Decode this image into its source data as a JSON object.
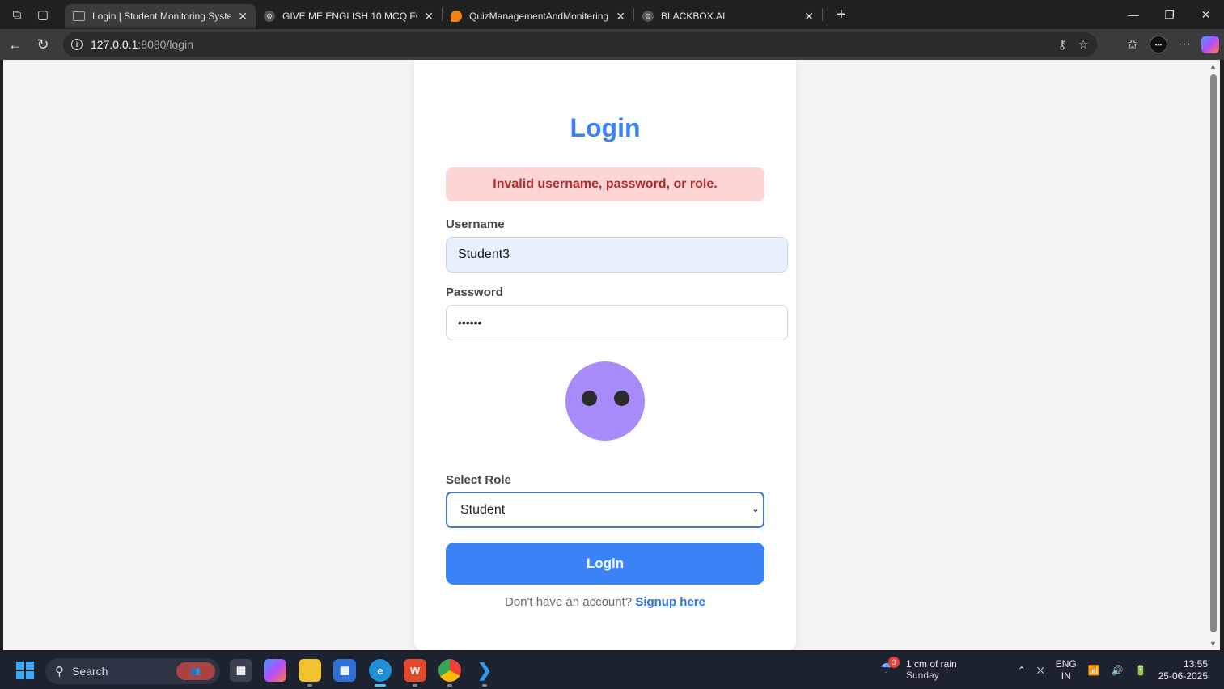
{
  "browser": {
    "tabs": [
      {
        "title": "Login | Student Monitoring Syster",
        "active": true
      },
      {
        "title": "GIVE ME ENGLISH 10 MCQ FOR 8",
        "active": false
      },
      {
        "title": "QuizManagementAndMonitering",
        "active": false
      },
      {
        "title": "BLACKBOX.AI",
        "active": false
      }
    ],
    "url_host": "127.0.0.1",
    "url_path": ":8080/login"
  },
  "page": {
    "title": "Login",
    "error": "Invalid username, password, or role.",
    "username_label": "Username",
    "username_value": "Student3",
    "password_label": "Password",
    "password_value": "••••••",
    "role_label": "Select Role",
    "role_value": "Student",
    "login_button": "Login",
    "signup_prompt": "Don't have an account?",
    "signup_link": "Signup here"
  },
  "taskbar": {
    "search_label": "Search",
    "weather_main": "1 cm of rain",
    "weather_sub": "Sunday",
    "weather_badge": "3",
    "lang_top": "ENG",
    "lang_bottom": "IN",
    "time": "13:55",
    "date": "25-06-2025"
  },
  "colors": {
    "accent": "#3b82f6",
    "error_bg": "#fdd5d5",
    "error_text": "#b02a2a",
    "avatar": "#a78bfa"
  }
}
